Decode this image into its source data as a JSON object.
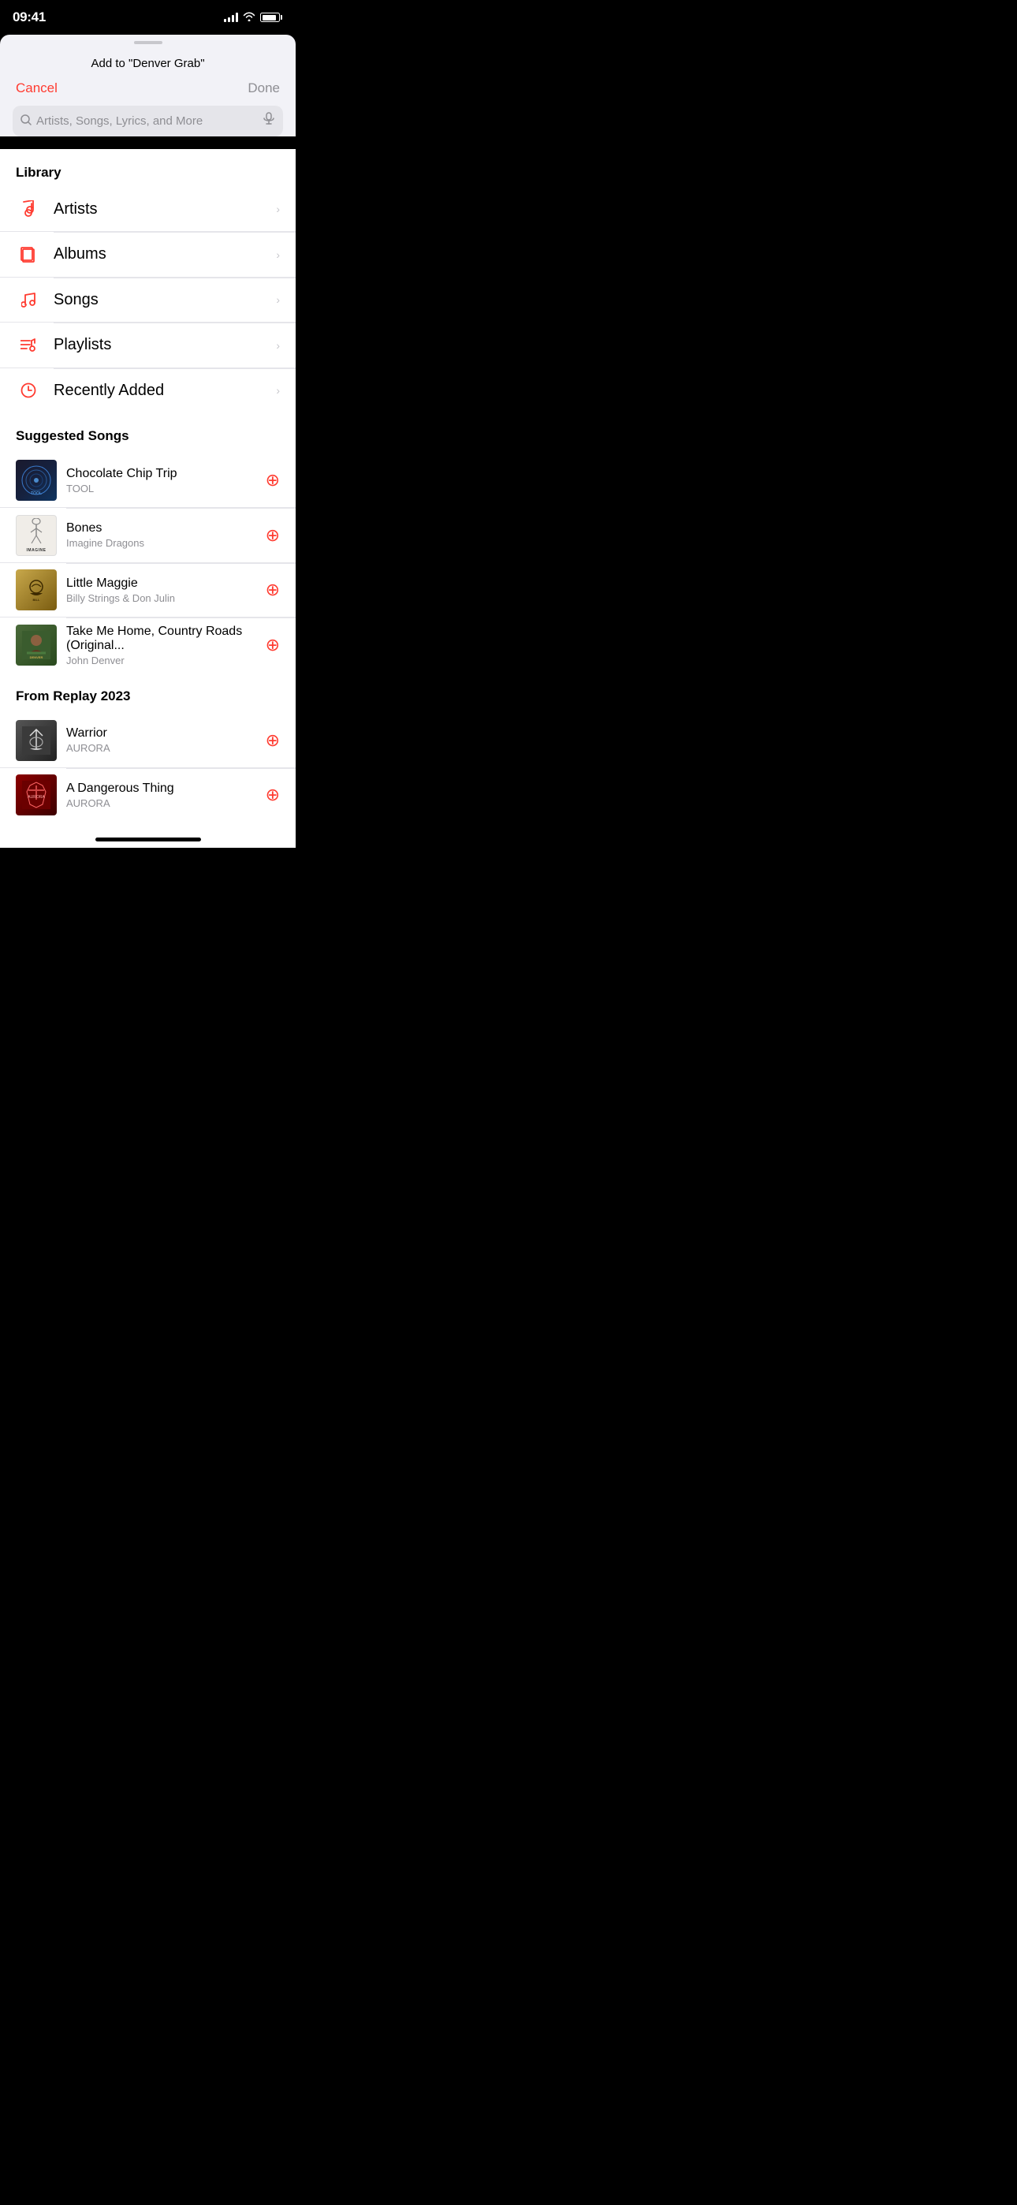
{
  "statusBar": {
    "time": "09:41"
  },
  "header": {
    "title": "Add to \"Denver Grab\"",
    "cancelLabel": "Cancel",
    "doneLabel": "Done"
  },
  "search": {
    "placeholder": "Artists, Songs, Lyrics, and More"
  },
  "library": {
    "sectionTitle": "Library",
    "items": [
      {
        "id": "artists",
        "label": "Artists",
        "icon": "🎤"
      },
      {
        "id": "albums",
        "label": "Albums",
        "icon": "🗂️"
      },
      {
        "id": "songs",
        "label": "Songs",
        "icon": "♪"
      },
      {
        "id": "playlists",
        "label": "Playlists",
        "icon": "♫"
      },
      {
        "id": "recently-added",
        "label": "Recently Added",
        "icon": "🕐"
      }
    ]
  },
  "suggestedSongs": {
    "sectionTitle": "Suggested Songs",
    "songs": [
      {
        "id": "chocolate-chip-trip",
        "title": "Chocolate Chip Trip",
        "artist": "TOOL",
        "artType": "tool"
      },
      {
        "id": "bones",
        "title": "Bones",
        "artist": "Imagine Dragons",
        "artType": "imagine"
      },
      {
        "id": "little-maggie",
        "title": "Little Maggie",
        "artist": "Billy Strings & Don Julin",
        "artType": "billy"
      },
      {
        "id": "take-me-home",
        "title": "Take Me Home, Country Roads (Original...",
        "artist": "John Denver",
        "artType": "denver"
      }
    ]
  },
  "replaySongs": {
    "sectionTitle": "From Replay 2023",
    "songs": [
      {
        "id": "warrior",
        "title": "Warrior",
        "artist": "AURORA",
        "artType": "aurora-warrior"
      },
      {
        "id": "dangerous-thing",
        "title": "A Dangerous Thing",
        "artist": "AURORA",
        "artType": "aurora-dangerous"
      }
    ]
  }
}
